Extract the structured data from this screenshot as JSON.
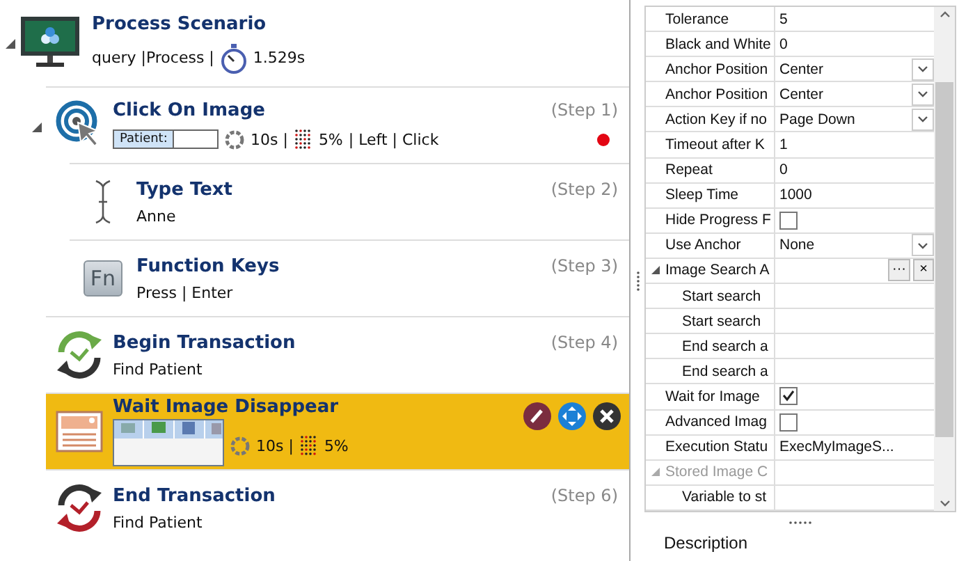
{
  "scenario": {
    "title": "Process Scenario",
    "expanded": true,
    "kind": "monitor",
    "meta": [
      {
        "kind": "text",
        "text": "query |Process |"
      },
      {
        "kind": "stopwatch",
        "text": "1.529s"
      }
    ],
    "steps": [
      {
        "title": "Click On Image",
        "step": "(Step 1)",
        "kind": "target",
        "expanded": true,
        "selected": false,
        "breakpoint": true,
        "details": [
          {
            "kind": "thumb",
            "text": "Patient:"
          },
          {
            "kind": "timeout",
            "text": "10s |"
          },
          {
            "kind": "tolerance",
            "text": "5%"
          },
          {
            "kind": "text",
            "text": "| Left | Click"
          }
        ],
        "children": [
          {
            "title": "Type Text",
            "step": "(Step 2)",
            "kind": "ibeam",
            "selected": false,
            "breakpoint": false,
            "details": [
              {
                "kind": "text",
                "text": "Anne"
              }
            ]
          },
          {
            "title": "Function Keys",
            "step": "(Step 3)",
            "kind": "fn",
            "key_label": "Fn",
            "selected": false,
            "breakpoint": false,
            "details": [
              {
                "kind": "text",
                "text": "Press | Enter"
              }
            ]
          }
        ]
      },
      {
        "title": "Begin Transaction",
        "step": "(Step 4)",
        "kind": "begin",
        "selected": false,
        "breakpoint": false,
        "details": [
          {
            "kind": "text",
            "text": "Find Patient"
          }
        ]
      },
      {
        "title": "Wait Image Disappear",
        "kind": "image",
        "selected": true,
        "breakpoint": false,
        "details": [
          {
            "kind": "screenshot"
          },
          {
            "kind": "timeout",
            "text": "10s |"
          },
          {
            "kind": "tolerance",
            "text": "5%"
          }
        ]
      },
      {
        "title": "End Transaction",
        "step": "(Step 6)",
        "kind": "end",
        "selected": false,
        "breakpoint": false,
        "details": [
          {
            "kind": "text",
            "text": "Find Patient"
          }
        ]
      }
    ]
  },
  "properties": [
    {
      "label": "Tolerance",
      "kind": "text",
      "value": "5"
    },
    {
      "label": "Black and White",
      "kind": "text",
      "value": "0"
    },
    {
      "label": "Anchor Position",
      "kind": "dropdown",
      "value": "Center"
    },
    {
      "label": "Anchor Position",
      "kind": "dropdown",
      "value": "Center"
    },
    {
      "label": "Action Key if no",
      "kind": "dropdown",
      "value": "Page Down"
    },
    {
      "label": "Timeout after K",
      "kind": "text",
      "value": "1"
    },
    {
      "label": "Repeat",
      "kind": "text",
      "value": "0"
    },
    {
      "label": "Sleep Time",
      "kind": "text",
      "value": "1000"
    },
    {
      "label": "Hide Progress F",
      "kind": "checkbox",
      "checked": false
    },
    {
      "label": "Use Anchor",
      "kind": "dropdown",
      "value": "None"
    },
    {
      "label": "Image Search A",
      "kind": "category",
      "expanded": true,
      "disabled": false,
      "buttons": [
        "···",
        "×"
      ],
      "children": [
        {
          "label": "Start search"
        },
        {
          "label": "Start search"
        },
        {
          "label": "End search a"
        },
        {
          "label": "End search a"
        }
      ]
    },
    {
      "label": "Wait for Image",
      "kind": "checkbox",
      "checked": true
    },
    {
      "label": "Advanced Imag",
      "kind": "checkbox",
      "checked": false
    },
    {
      "label": "Execution Statu",
      "kind": "text",
      "value": "ExecMyImageS..."
    },
    {
      "label": "Stored Image C",
      "kind": "category",
      "expanded": true,
      "disabled": true,
      "children": [
        {
          "label": "Variable to st"
        }
      ]
    }
  ],
  "description": {
    "title": "Description"
  }
}
